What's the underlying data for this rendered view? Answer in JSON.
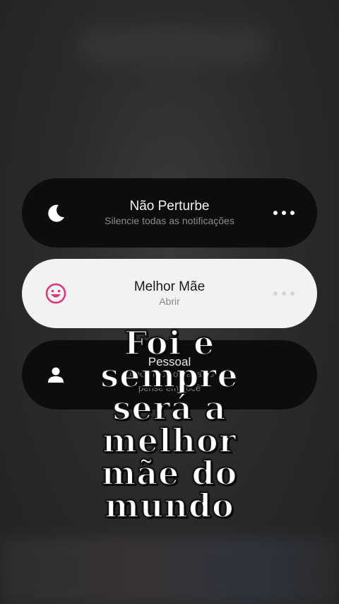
{
  "cards": [
    {
      "title": "Não Perturbe",
      "subtitle": "Silencie todas as notificações",
      "icon": "moon-icon"
    },
    {
      "title": "Melhor Mãe",
      "subtitle": "Abrir",
      "icon": "smile-icon",
      "accent": "#e0357a"
    },
    {
      "title": "Pessoal",
      "subtitle": "concentre no trabalho",
      "subtitle2": "pense em você",
      "icon": "person-icon"
    }
  ],
  "overlay_text": {
    "line1": "Foi e",
    "line2": "sempre",
    "line3": "será a",
    "line4": "melhor",
    "line5": "mãe do",
    "line6": "mundo"
  }
}
